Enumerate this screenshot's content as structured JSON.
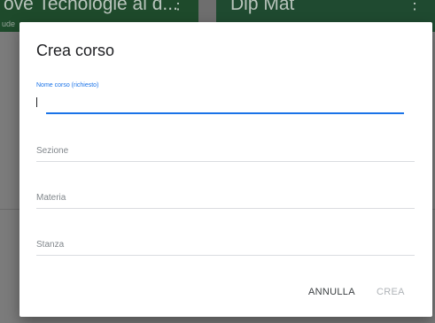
{
  "background": {
    "cards": [
      {
        "title": "ove Tecnologie al d...",
        "menu_icon": "more-vert-icon",
        "menu_glyph": "⋮",
        "subtitle": "ude"
      },
      {
        "title": "Dip Mat",
        "menu_icon": "more-vert-icon",
        "menu_glyph": "⋮",
        "subtitle": ""
      }
    ],
    "scrim_color": "#7b7b7b",
    "card_color": "#1e4a2b"
  },
  "dialog": {
    "title": "Crea corso",
    "fields": {
      "name": {
        "label": "Nome corso (richiesto)",
        "value": "",
        "active": true
      },
      "section": {
        "placeholder": "Sezione",
        "value": ""
      },
      "subject": {
        "placeholder": "Materia",
        "value": ""
      },
      "room": {
        "placeholder": "Stanza",
        "value": ""
      }
    },
    "actions": {
      "cancel_label": "ANNULLA",
      "create_label": "CREA",
      "create_enabled": false
    }
  },
  "colors": {
    "accent": "#1a73e8",
    "text_primary": "#202124",
    "text_disabled": "#b0b4b8",
    "divider": "#dadce0"
  }
}
